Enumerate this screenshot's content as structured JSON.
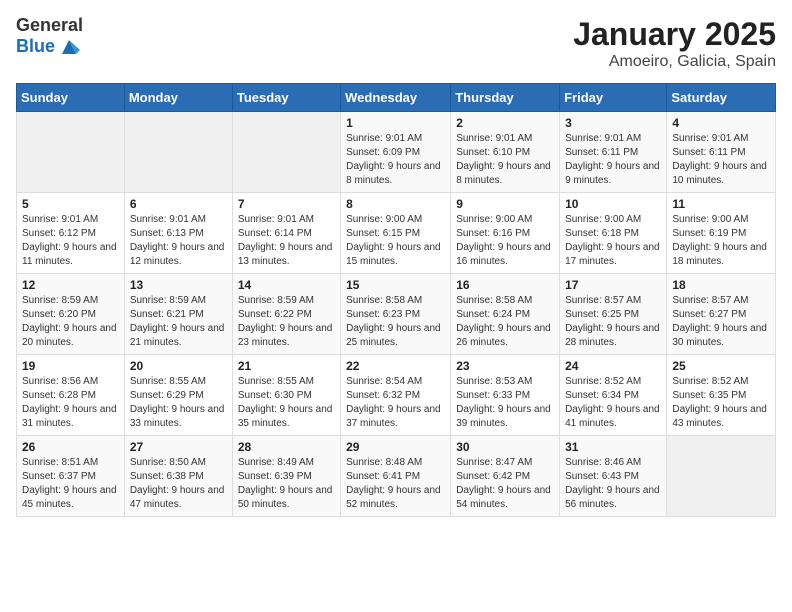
{
  "header": {
    "logo_general": "General",
    "logo_blue": "Blue",
    "title": "January 2025",
    "subtitle": "Amoeiro, Galicia, Spain"
  },
  "weekdays": [
    "Sunday",
    "Monday",
    "Tuesday",
    "Wednesday",
    "Thursday",
    "Friday",
    "Saturday"
  ],
  "weeks": [
    [
      {
        "num": "",
        "detail": ""
      },
      {
        "num": "",
        "detail": ""
      },
      {
        "num": "",
        "detail": ""
      },
      {
        "num": "1",
        "detail": "Sunrise: 9:01 AM\nSunset: 6:09 PM\nDaylight: 9 hours and 8 minutes."
      },
      {
        "num": "2",
        "detail": "Sunrise: 9:01 AM\nSunset: 6:10 PM\nDaylight: 9 hours and 8 minutes."
      },
      {
        "num": "3",
        "detail": "Sunrise: 9:01 AM\nSunset: 6:11 PM\nDaylight: 9 hours and 9 minutes."
      },
      {
        "num": "4",
        "detail": "Sunrise: 9:01 AM\nSunset: 6:11 PM\nDaylight: 9 hours and 10 minutes."
      }
    ],
    [
      {
        "num": "5",
        "detail": "Sunrise: 9:01 AM\nSunset: 6:12 PM\nDaylight: 9 hours and 11 minutes."
      },
      {
        "num": "6",
        "detail": "Sunrise: 9:01 AM\nSunset: 6:13 PM\nDaylight: 9 hours and 12 minutes."
      },
      {
        "num": "7",
        "detail": "Sunrise: 9:01 AM\nSunset: 6:14 PM\nDaylight: 9 hours and 13 minutes."
      },
      {
        "num": "8",
        "detail": "Sunrise: 9:00 AM\nSunset: 6:15 PM\nDaylight: 9 hours and 15 minutes."
      },
      {
        "num": "9",
        "detail": "Sunrise: 9:00 AM\nSunset: 6:16 PM\nDaylight: 9 hours and 16 minutes."
      },
      {
        "num": "10",
        "detail": "Sunrise: 9:00 AM\nSunset: 6:18 PM\nDaylight: 9 hours and 17 minutes."
      },
      {
        "num": "11",
        "detail": "Sunrise: 9:00 AM\nSunset: 6:19 PM\nDaylight: 9 hours and 18 minutes."
      }
    ],
    [
      {
        "num": "12",
        "detail": "Sunrise: 8:59 AM\nSunset: 6:20 PM\nDaylight: 9 hours and 20 minutes."
      },
      {
        "num": "13",
        "detail": "Sunrise: 8:59 AM\nSunset: 6:21 PM\nDaylight: 9 hours and 21 minutes."
      },
      {
        "num": "14",
        "detail": "Sunrise: 8:59 AM\nSunset: 6:22 PM\nDaylight: 9 hours and 23 minutes."
      },
      {
        "num": "15",
        "detail": "Sunrise: 8:58 AM\nSunset: 6:23 PM\nDaylight: 9 hours and 25 minutes."
      },
      {
        "num": "16",
        "detail": "Sunrise: 8:58 AM\nSunset: 6:24 PM\nDaylight: 9 hours and 26 minutes."
      },
      {
        "num": "17",
        "detail": "Sunrise: 8:57 AM\nSunset: 6:25 PM\nDaylight: 9 hours and 28 minutes."
      },
      {
        "num": "18",
        "detail": "Sunrise: 8:57 AM\nSunset: 6:27 PM\nDaylight: 9 hours and 30 minutes."
      }
    ],
    [
      {
        "num": "19",
        "detail": "Sunrise: 8:56 AM\nSunset: 6:28 PM\nDaylight: 9 hours and 31 minutes."
      },
      {
        "num": "20",
        "detail": "Sunrise: 8:55 AM\nSunset: 6:29 PM\nDaylight: 9 hours and 33 minutes."
      },
      {
        "num": "21",
        "detail": "Sunrise: 8:55 AM\nSunset: 6:30 PM\nDaylight: 9 hours and 35 minutes."
      },
      {
        "num": "22",
        "detail": "Sunrise: 8:54 AM\nSunset: 6:32 PM\nDaylight: 9 hours and 37 minutes."
      },
      {
        "num": "23",
        "detail": "Sunrise: 8:53 AM\nSunset: 6:33 PM\nDaylight: 9 hours and 39 minutes."
      },
      {
        "num": "24",
        "detail": "Sunrise: 8:52 AM\nSunset: 6:34 PM\nDaylight: 9 hours and 41 minutes."
      },
      {
        "num": "25",
        "detail": "Sunrise: 8:52 AM\nSunset: 6:35 PM\nDaylight: 9 hours and 43 minutes."
      }
    ],
    [
      {
        "num": "26",
        "detail": "Sunrise: 8:51 AM\nSunset: 6:37 PM\nDaylight: 9 hours and 45 minutes."
      },
      {
        "num": "27",
        "detail": "Sunrise: 8:50 AM\nSunset: 6:38 PM\nDaylight: 9 hours and 47 minutes."
      },
      {
        "num": "28",
        "detail": "Sunrise: 8:49 AM\nSunset: 6:39 PM\nDaylight: 9 hours and 50 minutes."
      },
      {
        "num": "29",
        "detail": "Sunrise: 8:48 AM\nSunset: 6:41 PM\nDaylight: 9 hours and 52 minutes."
      },
      {
        "num": "30",
        "detail": "Sunrise: 8:47 AM\nSunset: 6:42 PM\nDaylight: 9 hours and 54 minutes."
      },
      {
        "num": "31",
        "detail": "Sunrise: 8:46 AM\nSunset: 6:43 PM\nDaylight: 9 hours and 56 minutes."
      },
      {
        "num": "",
        "detail": ""
      }
    ]
  ]
}
